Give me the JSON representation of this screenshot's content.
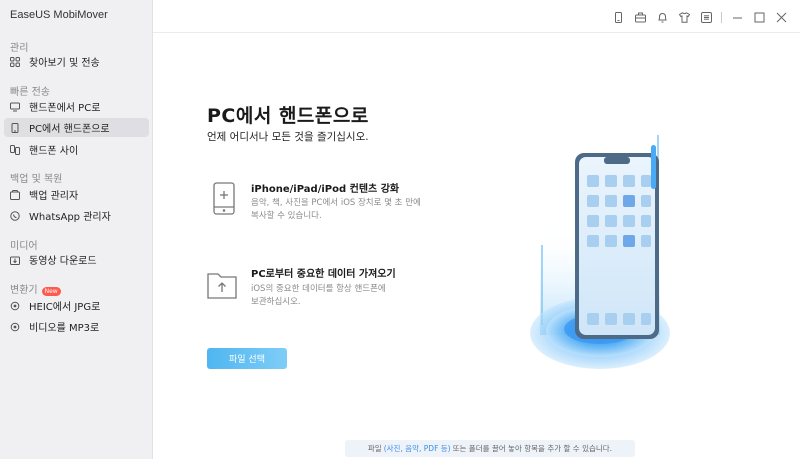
{
  "app": {
    "title": "EaseUS MobiMover"
  },
  "sidebar": {
    "sections": {
      "manage": "관리",
      "quick_transfer": "빠른 전송",
      "backup_restore": "백업 및 복원",
      "media": "미디어",
      "converter": "변환기"
    },
    "items": {
      "browse_transfer": "찾아보기 및 전송",
      "phone_to_pc": "핸드폰에서 PC로",
      "pc_to_phone": "PC에서 핸드폰으로",
      "phone_to_phone": "핸드폰 사이",
      "backup_manager": "백업 관리자",
      "whatsapp_manager": "WhatsApp 관리자",
      "video_download": "동영상 다운로드",
      "heic_to_jpg": "HEIC에서 JPG로",
      "video_to_mp3": "비디오를 MP3로"
    },
    "new_badge": "New",
    "active": "pc_to_phone"
  },
  "titlebar": {
    "icons": [
      "phone-icon",
      "toolbox-icon",
      "bell-icon",
      "shirt-icon",
      "menu-icon",
      "minimize-icon",
      "maximize-icon",
      "close-icon"
    ]
  },
  "main": {
    "title": "PC에서 핸드폰으로",
    "subtitle": "언제 어디서나 모든 것을 즐기십시오.",
    "features": [
      {
        "title": "iPhone/iPad/iPod 컨텐츠 강화",
        "desc_line1": "음악, 책, 사진을 PC에서 iOS 장치로 몇 초 만에",
        "desc_line2": "복사할 수 있습니다."
      },
      {
        "title": "PC로부터 중요한 데이터 가져오기",
        "desc_line1": "iOS의 중요한 데이터를 항상 핸드폰에",
        "desc_line2": "보관하십시오."
      }
    ],
    "select_button": "파일 선택",
    "footer": {
      "prefix": "파일",
      "highlight": "(사진, 음악, PDF 등)",
      "suffix": "또는 폴더를 끌어 놓아 항목을 추가 할 수 있습니다."
    }
  },
  "colors": {
    "accent": "#4fb6f0",
    "sidebar_bg": "#f0f0f2",
    "active_item_bg": "#dedee3",
    "badge": "#ff5a4e"
  }
}
